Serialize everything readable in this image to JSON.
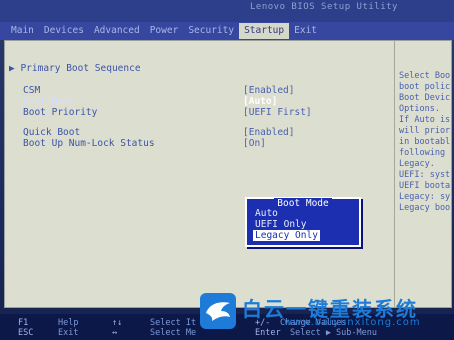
{
  "header": {
    "title": "Lenovo BIOS Setup Utility"
  },
  "menu": [
    {
      "label": "Main",
      "active": false
    },
    {
      "label": "Devices",
      "active": false
    },
    {
      "label": "Advanced",
      "active": false
    },
    {
      "label": "Power",
      "active": false
    },
    {
      "label": "Security",
      "active": false
    },
    {
      "label": "Startup",
      "active": true
    },
    {
      "label": "Exit",
      "active": false
    }
  ],
  "main": {
    "section_title": "▶ Primary Boot Sequence",
    "settings": [
      {
        "label": "CSM",
        "value": "[Enabled]"
      },
      {
        "label": "Boot Mode",
        "value": "[Auto]"
      },
      {
        "label": "Boot Priority",
        "value": "[UEFI First]"
      },
      {
        "label": "Quick Boot",
        "value": "[Enabled]"
      },
      {
        "label": "Boot Up Num-Lock Status",
        "value": "[On]"
      }
    ]
  },
  "popup": {
    "title": "Boot Mode",
    "options": [
      "Auto",
      "UEFI Only",
      "Legacy Only"
    ],
    "selected": "Legacy Only"
  },
  "help": {
    "lines": [
      "Select Boo",
      "boot polic",
      "Boot Devic",
      "Options.",
      "If Auto is",
      "will prior",
      "in bootabl",
      "following",
      "Legacy.",
      "UEFI: syst",
      "UEFI boota",
      "Legacy: sy",
      "Legacy boo"
    ]
  },
  "footer": {
    "keys": [
      {
        "key": "F1",
        "desc": "Help"
      },
      {
        "key": "ESC",
        "desc": "Exit"
      },
      {
        "key": "↑↓",
        "desc": "Select It"
      },
      {
        "key": "↔",
        "desc": "Select Me"
      },
      {
        "key": "+/-",
        "desc": "Change Values"
      },
      {
        "key": "Enter",
        "desc": "Select ▶ Sub-Menu"
      }
    ]
  },
  "watermark": {
    "brand": "白云一键重装系统",
    "url": "www.baiyunxitong.com"
  },
  "colors": {
    "menu_bar": "#3747a0",
    "panel_bg": "#dcdfcf",
    "text_blue": "#3d52a8",
    "popup_bg": "#1c2fb0",
    "watermark": "#1e7bd8"
  }
}
